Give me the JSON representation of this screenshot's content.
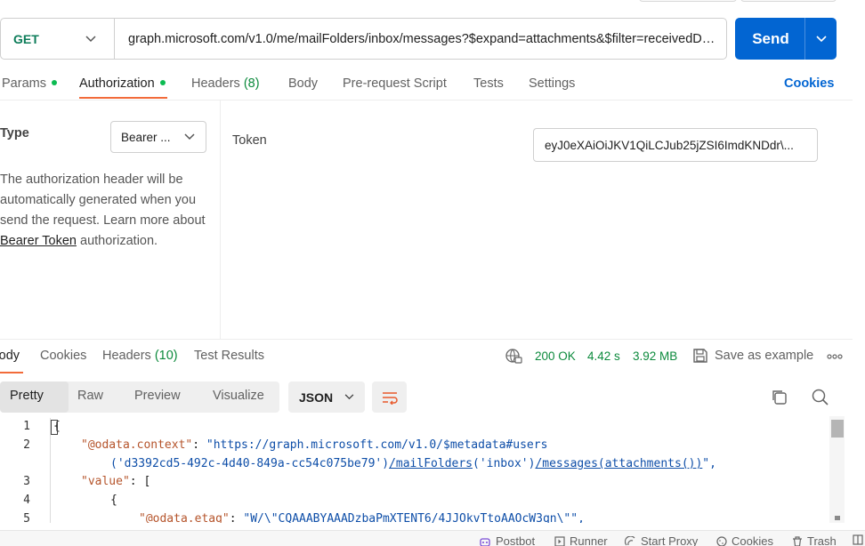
{
  "request": {
    "method": "GET",
    "url": "graph.microsoft.com/v1.0/me/mailFolders/inbox/messages?$expand=attachments&$filter=receivedDateTime",
    "send_label": "Send"
  },
  "request_tabs": {
    "params": "Params",
    "authorization": "Authorization",
    "headers": "Headers",
    "headers_count": "(8)",
    "body": "Body",
    "pre_request": "Pre-request Script",
    "tests": "Tests",
    "settings": "Settings",
    "cookies": "Cookies"
  },
  "auth": {
    "type_label": "Type",
    "type_value": "Bearer ...",
    "description_1": "The authorization header will be automatically generated when you send the request. Learn more about ",
    "description_link": "Bearer Token",
    "description_2": " authorization.",
    "token_label": "Token",
    "token_value": "eyJ0eXAiOiJKV1QiLCJub25jZSI6ImdKNDdr\\..."
  },
  "response_tabs": {
    "body": "Body",
    "cookies": "Cookies",
    "headers": "Headers",
    "headers_count": "(10)",
    "test_results": "Test Results"
  },
  "response_meta": {
    "status": "200 OK",
    "time": "4.42 s",
    "size": "3.92 MB",
    "save_example": "Save as example"
  },
  "view_tabs": {
    "pretty": "Pretty",
    "raw": "Raw",
    "preview": "Preview",
    "visualize": "Visualize",
    "format": "JSON"
  },
  "code": {
    "line_numbers": [
      "1",
      "2",
      "3",
      "4",
      "5"
    ],
    "l1": "{",
    "l2_key": "\"@odata.context\"",
    "l2_sep": ": ",
    "l2_val_a": "\"https://graph.microsoft.com/v1.0/$metadata#users",
    "l2_val_b1": "('d3392cd5-492c-4d40-849a-cc54c075be79')",
    "l2_val_b2": "/mailFolders",
    "l2_val_b3": "('inbox')",
    "l2_val_b4": "/messages(attachments())",
    "l2_val_b5": "\",",
    "l3_key": "\"value\"",
    "l3_rest": ": [",
    "l4": "{",
    "l5_key": "\"@odata.etag\"",
    "l5_sep": ": ",
    "l5_val": "\"W/\\\"CQAAABYAAADzbaPmXTENT6/4JJOkvTtoAAOcW3qn\\\"\","
  },
  "footer": {
    "postbot": "Postbot",
    "runner": "Runner",
    "start_proxy": "Start Proxy",
    "cookies": "Cookies",
    "trash": "Trash"
  },
  "colors": {
    "accent": "#0265d2",
    "tab_underline": "#f26b3a",
    "status_green": "#0c8a3c",
    "method_green": "#0c7c59"
  }
}
